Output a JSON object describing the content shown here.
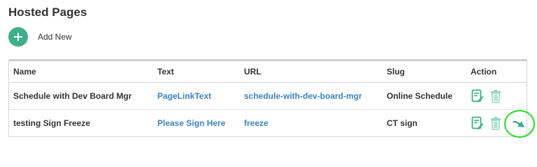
{
  "page": {
    "title": "Hosted Pages"
  },
  "add_new": {
    "label": "Add New",
    "icon": "plus-icon"
  },
  "colors": {
    "accent_green": "#3daf8a",
    "link_blue": "#3b83c0",
    "highlight_ring": "#22dd22"
  },
  "table": {
    "columns": [
      "Name",
      "Text",
      "URL",
      "Slug",
      "Action"
    ],
    "rows": [
      {
        "name": "Schedule with Dev Board Mgr",
        "text": "PageLinkText",
        "url": "schedule-with-dev-board-mgr",
        "slug": "Online Schedule",
        "actions": [
          "edit-icon",
          "trash-icon"
        ]
      },
      {
        "name": "testing Sign Freeze",
        "text": "Please Sign Here",
        "url": "freeze",
        "slug": "CT sign",
        "actions": [
          "edit-icon",
          "trash-icon",
          "go-arrow-icon"
        ]
      }
    ]
  }
}
